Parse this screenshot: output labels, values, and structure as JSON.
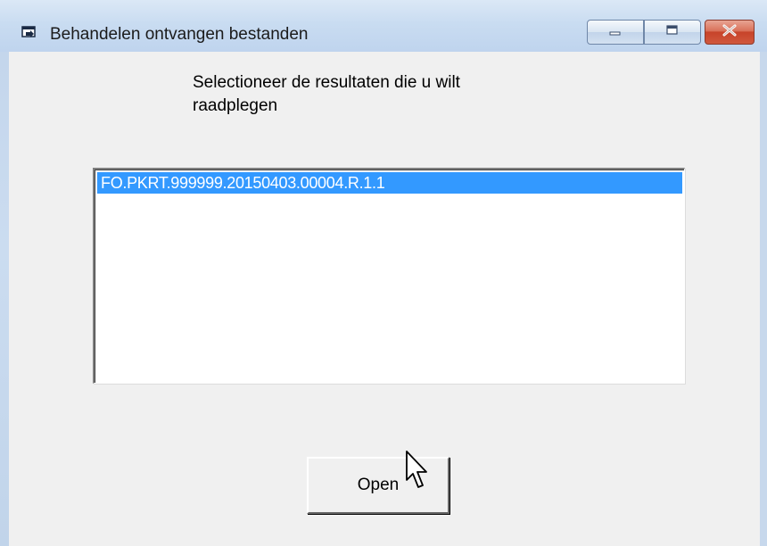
{
  "window": {
    "title": "Behandelen ontvangen bestanden",
    "icon": "app-window-icon"
  },
  "caption": {
    "minimize_icon": "minimize-icon",
    "maximize_icon": "maximize-icon",
    "close_icon": "close-icon"
  },
  "main": {
    "prompt": "Selectioneer de resultaten die u wilt raadplegen",
    "list": {
      "items": [
        {
          "label": "FO.PKRT.999999.20150403.00004.R.1.1",
          "selected": true
        }
      ]
    },
    "open_button": "Open"
  },
  "colors": {
    "selection": "#3399ff",
    "close_button": "#c7432a",
    "titlebar": "#c9dcf1"
  }
}
